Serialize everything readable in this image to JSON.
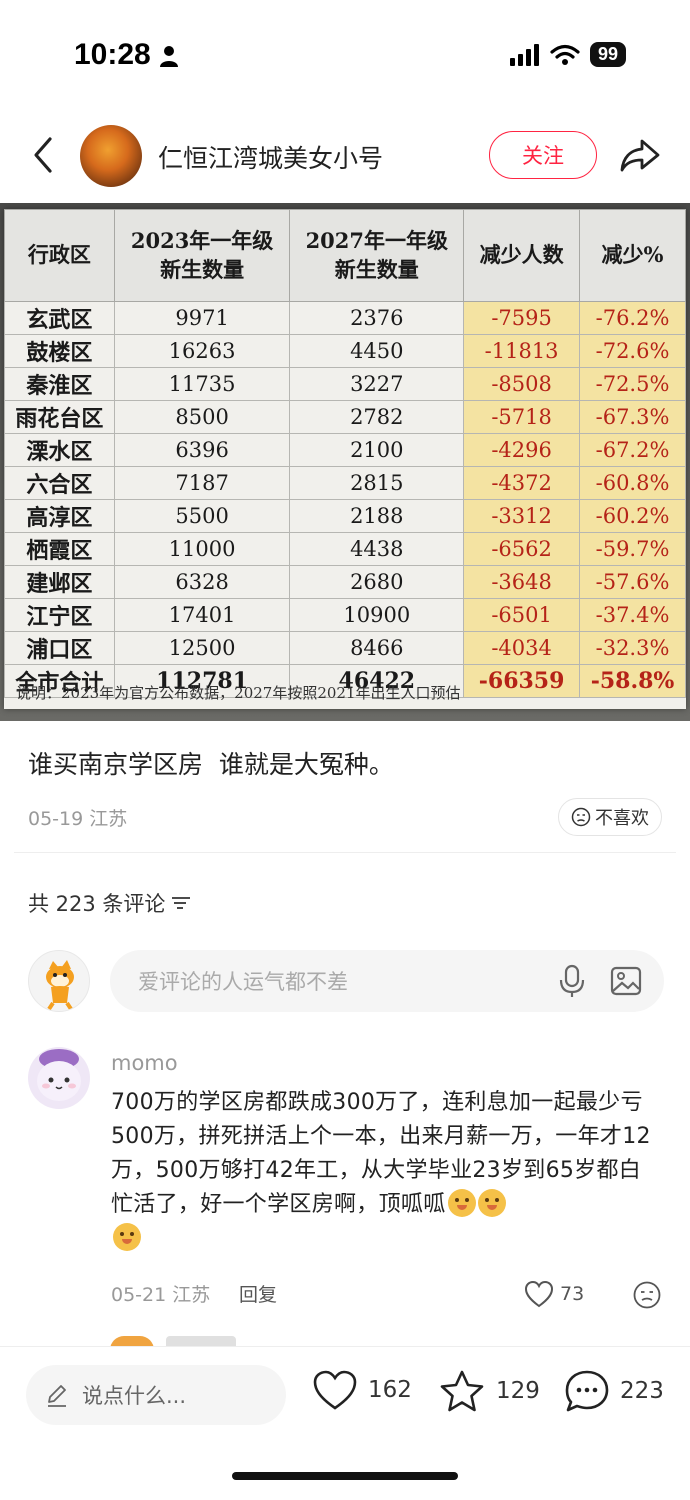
{
  "status_bar": {
    "time": "10:28",
    "battery": "99"
  },
  "header": {
    "author": "仁恒江湾城美女小号",
    "follow_label": "关注"
  },
  "table": {
    "headers": [
      "行政区",
      "2023年一年级\n新生数量",
      "2027年一年级\n新生数量",
      "减少人数",
      "减少%"
    ],
    "rows": [
      [
        "玄武区",
        "9971",
        "2376",
        "-7595",
        "-76.2%"
      ],
      [
        "鼓楼区",
        "16263",
        "4450",
        "-11813",
        "-72.6%"
      ],
      [
        "秦淮区",
        "11735",
        "3227",
        "-8508",
        "-72.5%"
      ],
      [
        "雨花台区",
        "8500",
        "2782",
        "-5718",
        "-67.3%"
      ],
      [
        "溧水区",
        "6396",
        "2100",
        "-4296",
        "-67.2%"
      ],
      [
        "六合区",
        "7187",
        "2815",
        "-4372",
        "-60.8%"
      ],
      [
        "高淳区",
        "5500",
        "2188",
        "-3312",
        "-60.2%"
      ],
      [
        "栖霞区",
        "11000",
        "4438",
        "-6562",
        "-59.7%"
      ],
      [
        "建邺区",
        "6328",
        "2680",
        "-3648",
        "-57.6%"
      ],
      [
        "江宁区",
        "17401",
        "10900",
        "-6501",
        "-37.4%"
      ],
      [
        "浦口区",
        "12500",
        "8466",
        "-4034",
        "-32.3%"
      ],
      [
        "全市合计",
        "112781",
        "46422",
        "-66359",
        "-58.8%"
      ]
    ],
    "note": "说明：2023年为官方公布数据，2027年按照2021年出生人口预估"
  },
  "post": {
    "text": "谁买南京学区房  谁就是大冤种。",
    "meta": "05-19 江苏",
    "dislike_label": "不喜欢"
  },
  "comments": {
    "count_label": "共 223 条评论",
    "input_placeholder": "爱评论的人运气都不差",
    "items": [
      {
        "name": "momo",
        "text": "700万的学区房都跌成300万了，连利息加一起最少亏500万，拼死拼活上个一本，出来月薪一万，一年才12万，500万够打42年工，从大学毕业23岁到65岁都白忙活了，好一个学区房啊，顶呱呱",
        "meta": "05-21 江苏",
        "reply_label": "回复",
        "likes": "73"
      }
    ]
  },
  "bottom_bar": {
    "say_placeholder": "说点什么...",
    "likes": "162",
    "stars": "129",
    "comments": "223"
  },
  "icons": [
    "person-icon",
    "signal-icon",
    "wifi-icon",
    "back-icon",
    "share-icon",
    "dislike-face-icon",
    "sort-icon",
    "mic-icon",
    "image-icon",
    "heart-icon",
    "star-icon",
    "comment-icon",
    "pencil-icon"
  ]
}
